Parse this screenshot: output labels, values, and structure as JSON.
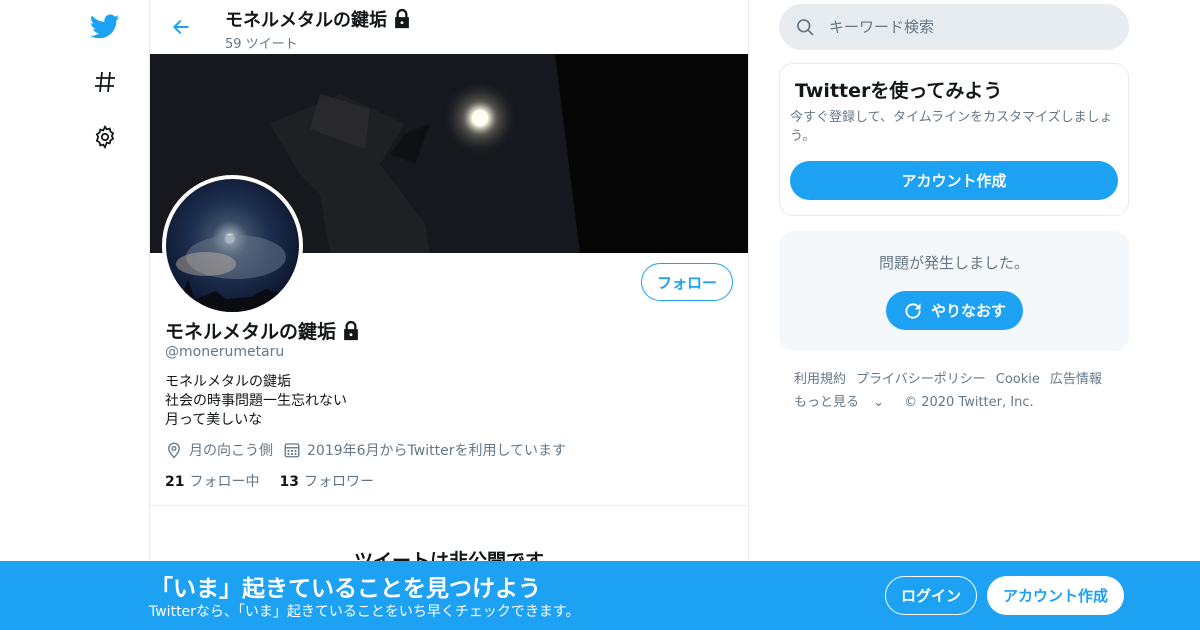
{
  "nav": {
    "icons": [
      "twitter-bird-icon",
      "hashtag-icon",
      "gear-icon"
    ]
  },
  "header": {
    "title": "モネルメタルの鍵垢",
    "tweet_count": "59 ツイート"
  },
  "profile": {
    "name": "モネルメタルの鍵垢",
    "handle": "@monerumetaru",
    "bio": [
      "モネルメタルの鍵垢",
      "社会の時事問題一生忘れない",
      "月って美しいな"
    ],
    "location": "月の向こう側",
    "joined": "2019年6月からTwitterを利用しています",
    "following_count": "21",
    "following_label": "フォロー中",
    "followers_count": "13",
    "followers_label": "フォロワー",
    "follow_button": "フォロー",
    "private_notice": "ツイートは非公開です"
  },
  "search": {
    "placeholder": "キーワード検索"
  },
  "signup_card": {
    "title": "Twitterを使ってみよう",
    "description": "今すぐ登録して、タイムラインをカスタマイズしましょう。",
    "button": "アカウント作成"
  },
  "error_box": {
    "message": "問題が発生しました。",
    "retry": "やりなおす"
  },
  "footer": {
    "links": [
      "利用規約",
      "プライバシーポリシー",
      "Cookie",
      "広告情報"
    ],
    "more": "もっと見る",
    "copyright": "© 2020 Twitter, Inc."
  },
  "bottom_bar": {
    "title": "「いま」起きていることを見つけよう",
    "subtitle": "Twitterなら、「いま」起きていることをいち早くチェックできます。",
    "login": "ログイン",
    "signup": "アカウント作成"
  },
  "colors": {
    "accent": "#1da1f2",
    "text": "#14171a",
    "secondary": "#657786",
    "border": "#e6ecf0"
  }
}
